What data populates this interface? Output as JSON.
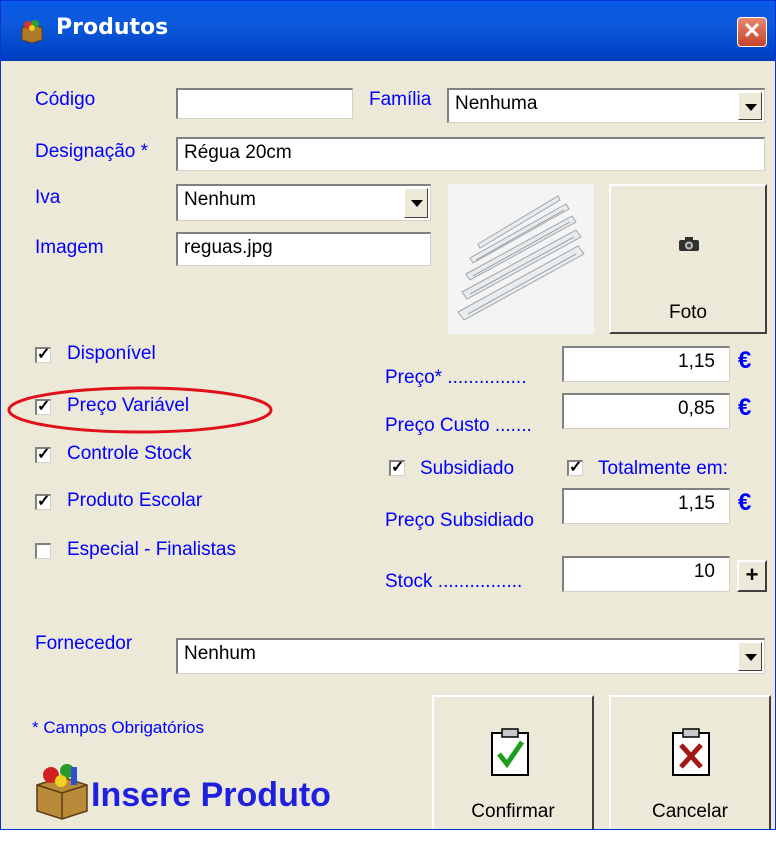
{
  "window": {
    "title": "Produtos",
    "close_glyph": "✕"
  },
  "form": {
    "codigo": {
      "label": "Código",
      "value": ""
    },
    "familia": {
      "label": "Família",
      "value": "Nenhuma"
    },
    "designacao": {
      "label": "Designação *",
      "value": "Régua 20cm"
    },
    "iva": {
      "label": "Iva",
      "value": "Nenhum"
    },
    "imagem": {
      "label": "Imagem",
      "value": "reguas.jpg"
    },
    "foto_button": {
      "label": "Foto",
      "icon": "camera-icon"
    }
  },
  "checks": {
    "disponivel": {
      "label": "Disponível",
      "checked": true
    },
    "preco_variavel": {
      "label": "Preço Variável",
      "checked": true
    },
    "controle_stock": {
      "label": "Controle Stock",
      "checked": true
    },
    "produto_escolar": {
      "label": "Produto Escolar",
      "checked": true
    },
    "especial": {
      "label": "Especial - Finalistas",
      "checked": false
    },
    "subsidiado": {
      "label": "Subsidiado",
      "checked": true
    },
    "totalmente": {
      "label": "Totalmente em:",
      "checked": true
    }
  },
  "prices": {
    "preco": {
      "label": "Preço* ...............",
      "value": "1,15"
    },
    "preco_custo": {
      "label": "Preço Custo .......",
      "value": "0,85"
    },
    "preco_subsidiado": {
      "label": "Preço Subsidiado",
      "value": "1,15"
    },
    "stock": {
      "label": "Stock ................",
      "value": "10"
    },
    "currency": "€",
    "plus": "+"
  },
  "fornecedor": {
    "label": "Fornecedor",
    "value": "Nenhum"
  },
  "footer": {
    "required_note": "* Campos Obrigatórios",
    "title": "Insere Produto",
    "confirm_label": "Confirmar",
    "cancel_label": "Cancelar"
  },
  "colors": {
    "label_blue": "#0000FF",
    "highlight_red": "#E0101A",
    "title_bar": "#0A5CE8"
  }
}
